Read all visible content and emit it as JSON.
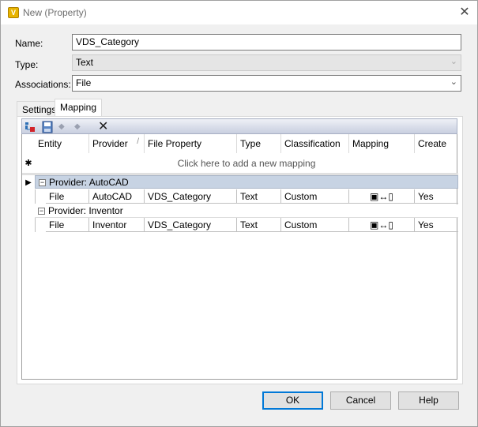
{
  "window": {
    "title": "New (Property)",
    "app_icon_letter": "V"
  },
  "form": {
    "name_label": "Name:",
    "name_value": "VDS_Category",
    "type_label": "Type:",
    "type_value": "Text",
    "associations_label": "Associations:",
    "associations_value": "File"
  },
  "tabs": [
    {
      "label": "Settings",
      "active": false
    },
    {
      "label": "Mapping",
      "active": true
    }
  ],
  "toolbar": {
    "icons": [
      "add-mapping-icon",
      "save-icon",
      "move-up-icon",
      "move-down-icon",
      "delete-icon"
    ]
  },
  "grid": {
    "columns": [
      "Entity",
      "Provider",
      "File Property",
      "Type",
      "Classification",
      "Mapping",
      "Create"
    ],
    "new_row_text": "Click here to add a new mapping",
    "groups": [
      {
        "label": "Provider: AutoCAD",
        "rows": [
          {
            "entity": "File",
            "provider": "AutoCAD",
            "file_property": "VDS_Category",
            "type": "Text",
            "classification": "Custom",
            "create": "Yes"
          }
        ]
      },
      {
        "label": "Provider: Inventor",
        "rows": [
          {
            "entity": "File",
            "provider": "Inventor",
            "file_property": "VDS_Category",
            "type": "Text",
            "classification": "Custom",
            "create": "Yes"
          }
        ]
      }
    ]
  },
  "buttons": {
    "ok": "OK",
    "cancel": "Cancel",
    "help": "Help"
  },
  "colors": {
    "group_selected": "#c7d3e3",
    "toolbar": "#c9cfe0",
    "accent": "#0078d7"
  }
}
